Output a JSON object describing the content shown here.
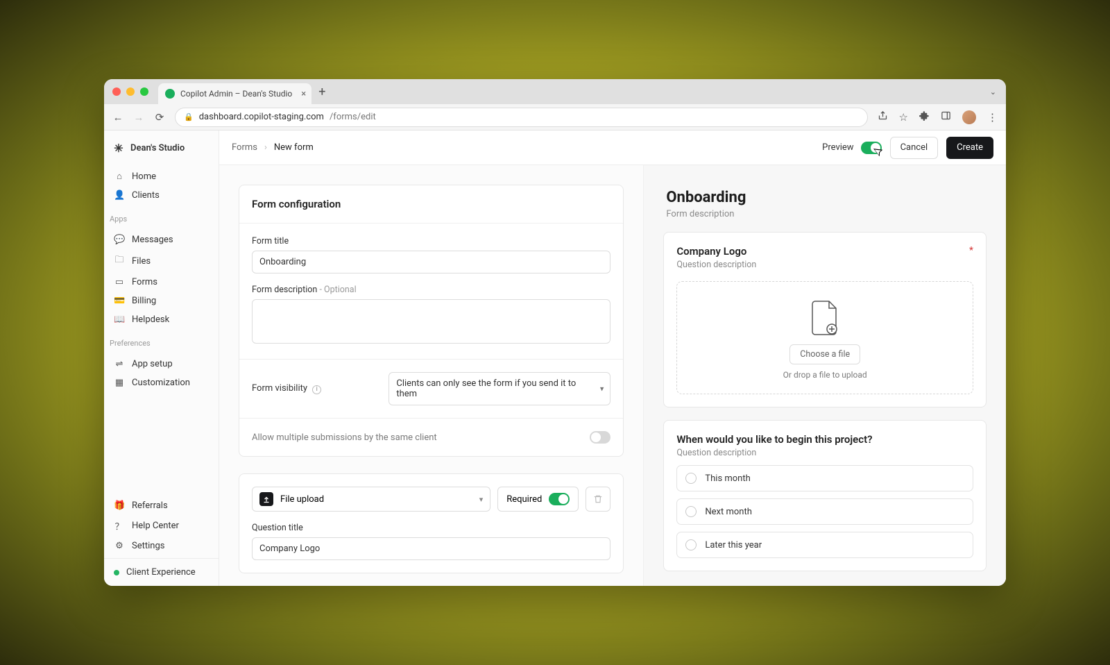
{
  "browser": {
    "tab_title": "Copilot Admin – Dean's Studio",
    "url_host": "dashboard.copilot-staging.com",
    "url_path": "/forms/edit"
  },
  "workspace": {
    "name": "Dean's Studio"
  },
  "sidebar": {
    "main": [
      {
        "label": "Home",
        "icon": "home"
      },
      {
        "label": "Clients",
        "icon": "users"
      }
    ],
    "apps_heading": "Apps",
    "apps": [
      {
        "label": "Messages",
        "icon": "message"
      },
      {
        "label": "Files",
        "icon": "folder"
      },
      {
        "label": "Forms",
        "icon": "form"
      },
      {
        "label": "Billing",
        "icon": "card"
      },
      {
        "label": "Helpdesk",
        "icon": "book"
      }
    ],
    "prefs_heading": "Preferences",
    "prefs": [
      {
        "label": "App setup",
        "icon": "sliders"
      },
      {
        "label": "Customization",
        "icon": "grid"
      }
    ],
    "footer": [
      {
        "label": "Referrals",
        "icon": "gift"
      },
      {
        "label": "Help Center",
        "icon": "help"
      },
      {
        "label": "Settings",
        "icon": "gear"
      }
    ],
    "client_experience": "Client Experience"
  },
  "topbar": {
    "crumb_root": "Forms",
    "crumb_current": "New form",
    "preview_label": "Preview",
    "preview_on": true,
    "cancel": "Cancel",
    "create": "Create"
  },
  "form_config": {
    "section_title": "Form configuration",
    "title_label": "Form title",
    "title_value": "Onboarding",
    "desc_label": "Form description",
    "desc_optional": " - Optional",
    "desc_value": "",
    "visibility_label": "Form visibility",
    "visibility_value": "Clients can only see the form if you send it to them",
    "multi_label": "Allow multiple submissions by the same client",
    "multi_on": false
  },
  "question_builder": {
    "type_label": "File upload",
    "required_label": "Required",
    "required_on": true,
    "qtitle_label": "Question title",
    "qtitle_value": "Company Logo"
  },
  "preview": {
    "title": "Onboarding",
    "subtitle": "Form description",
    "q1": {
      "title": "Company Logo",
      "subtitle": "Question description",
      "required": true,
      "choose_label": "Choose a file",
      "drop_label": "Or drop a file to upload"
    },
    "q2": {
      "title": "When would you like to begin this project?",
      "subtitle": "Question description",
      "options": [
        "This month",
        "Next month",
        "Later this year"
      ]
    }
  }
}
